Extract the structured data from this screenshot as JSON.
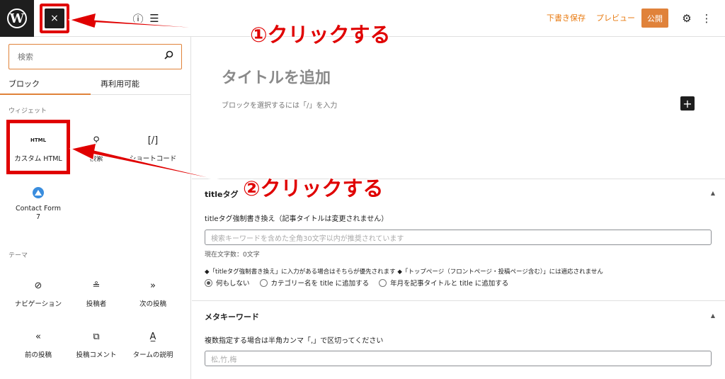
{
  "topbar": {
    "logo_letter": "W",
    "close_label": "×",
    "save_draft": "下書き保存",
    "preview": "プレビュー",
    "publish": "公開",
    "info_icon": "ⓘ",
    "outline_icon": "☰",
    "settings_icon": "⚙",
    "more_icon": "⋮"
  },
  "inserter": {
    "search_placeholder": "検索",
    "tabs": [
      {
        "label": "ブロック",
        "active": true
      },
      {
        "label": "再利用可能",
        "active": false
      }
    ],
    "widgets_label": "ウィジェット",
    "widgets": [
      {
        "label": "カスタム HTML",
        "icon": "HTML"
      },
      {
        "label": "検索",
        "icon": "⚲"
      },
      {
        "label": "ショートコード",
        "icon": "[/]"
      },
      {
        "label": "Contact Form 7",
        "icon": "▲"
      }
    ],
    "theme_label": "テーマ",
    "theme_blocks": [
      {
        "label": "ナビゲーション",
        "icon": "⊘"
      },
      {
        "label": "投稿者",
        "icon": "≗"
      },
      {
        "label": "次の投稿",
        "icon": "»"
      },
      {
        "label": "前の投稿",
        "icon": "«"
      },
      {
        "label": "投稿コメント",
        "icon": "⧉"
      },
      {
        "label": "タームの説明",
        "icon": "A̲"
      }
    ]
  },
  "editor": {
    "title_placeholder": "タイトルを追加",
    "block_placeholder": "ブロックを選択するには「/」を入力",
    "add_block": "+"
  },
  "title_tag_box": {
    "title": "titleタグ",
    "field_label": "titleタグ強制書き換え（記事タイトルは変更されません）",
    "input_placeholder": "検索キーワードを含めた全角30文字以内が推奨されています",
    "char_count": "現在文字数：0文字",
    "note": "◆「titleタグ強制書き換え」に入力がある場合はそちらが優先されます ◆「トップページ（フロントページ・投稿ページ含む）」には適応されません",
    "radios": [
      {
        "label": "何もしない",
        "checked": true
      },
      {
        "label": "カテゴリー名を title に追加する",
        "checked": false
      },
      {
        "label": "年月を記事タイトルと title に追加する",
        "checked": false
      }
    ]
  },
  "meta_keyword_box": {
    "title": "メタキーワード",
    "field_label": "複数指定する場合は半角カンマ「,」で区切ってください",
    "input_placeholder": "松,竹,梅"
  },
  "annotations": {
    "step1": "①クリックする",
    "step2": "②クリックする"
  },
  "colors": {
    "accent": "#e0823a",
    "annotation_red": "#e00000",
    "dark": "#1e1e1e"
  }
}
